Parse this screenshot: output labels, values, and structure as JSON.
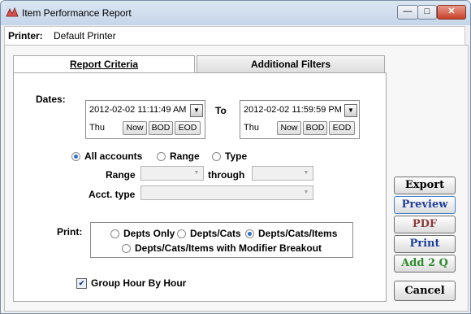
{
  "window": {
    "title": "Item Performance Report",
    "minimize": "—",
    "maximize": "□",
    "close": "✕"
  },
  "printer": {
    "label": "Printer:",
    "value": "Default Printer"
  },
  "tabs": [
    {
      "label": "Report Criteria",
      "active": true
    },
    {
      "label": "Additional Filters",
      "active": false
    }
  ],
  "dates": {
    "label": "Dates:",
    "to_label": "To",
    "from": {
      "value": "2012-02-02 11:11:49 AM",
      "day": "Thu"
    },
    "to": {
      "value": "2012-02-02 11:59:59 PM",
      "day": "Thu"
    },
    "buttons": [
      "Now",
      "BOD",
      "EOD"
    ]
  },
  "accounts": {
    "options": [
      {
        "label": "All accounts",
        "selected": true
      },
      {
        "label": "Range",
        "selected": false
      },
      {
        "label": "Type",
        "selected": false
      }
    ],
    "range_label": "Range",
    "through_label": "through",
    "acct_type_label": "Acct. type"
  },
  "print": {
    "label": "Print:",
    "options": [
      {
        "label": "Depts Only",
        "selected": false
      },
      {
        "label": "Depts/Cats",
        "selected": false
      },
      {
        "label": "Depts/Cats/Items",
        "selected": true
      },
      {
        "label": "Depts/Cats/Items with Modifier Breakout",
        "selected": false
      }
    ]
  },
  "group_hour": {
    "label": "Group Hour By Hour",
    "checked": true
  },
  "actions": [
    {
      "label": "Export",
      "color": "#000000"
    },
    {
      "label": "Preview",
      "color": "#1f3f9f"
    },
    {
      "label": "PDF",
      "color": "#8b3a3a"
    },
    {
      "label": "Print",
      "color": "#1f3f9f"
    },
    {
      "label": "Add 2 Q",
      "color": "#2e8b2e"
    },
    {
      "label": "Cancel",
      "color": "#000000"
    }
  ]
}
